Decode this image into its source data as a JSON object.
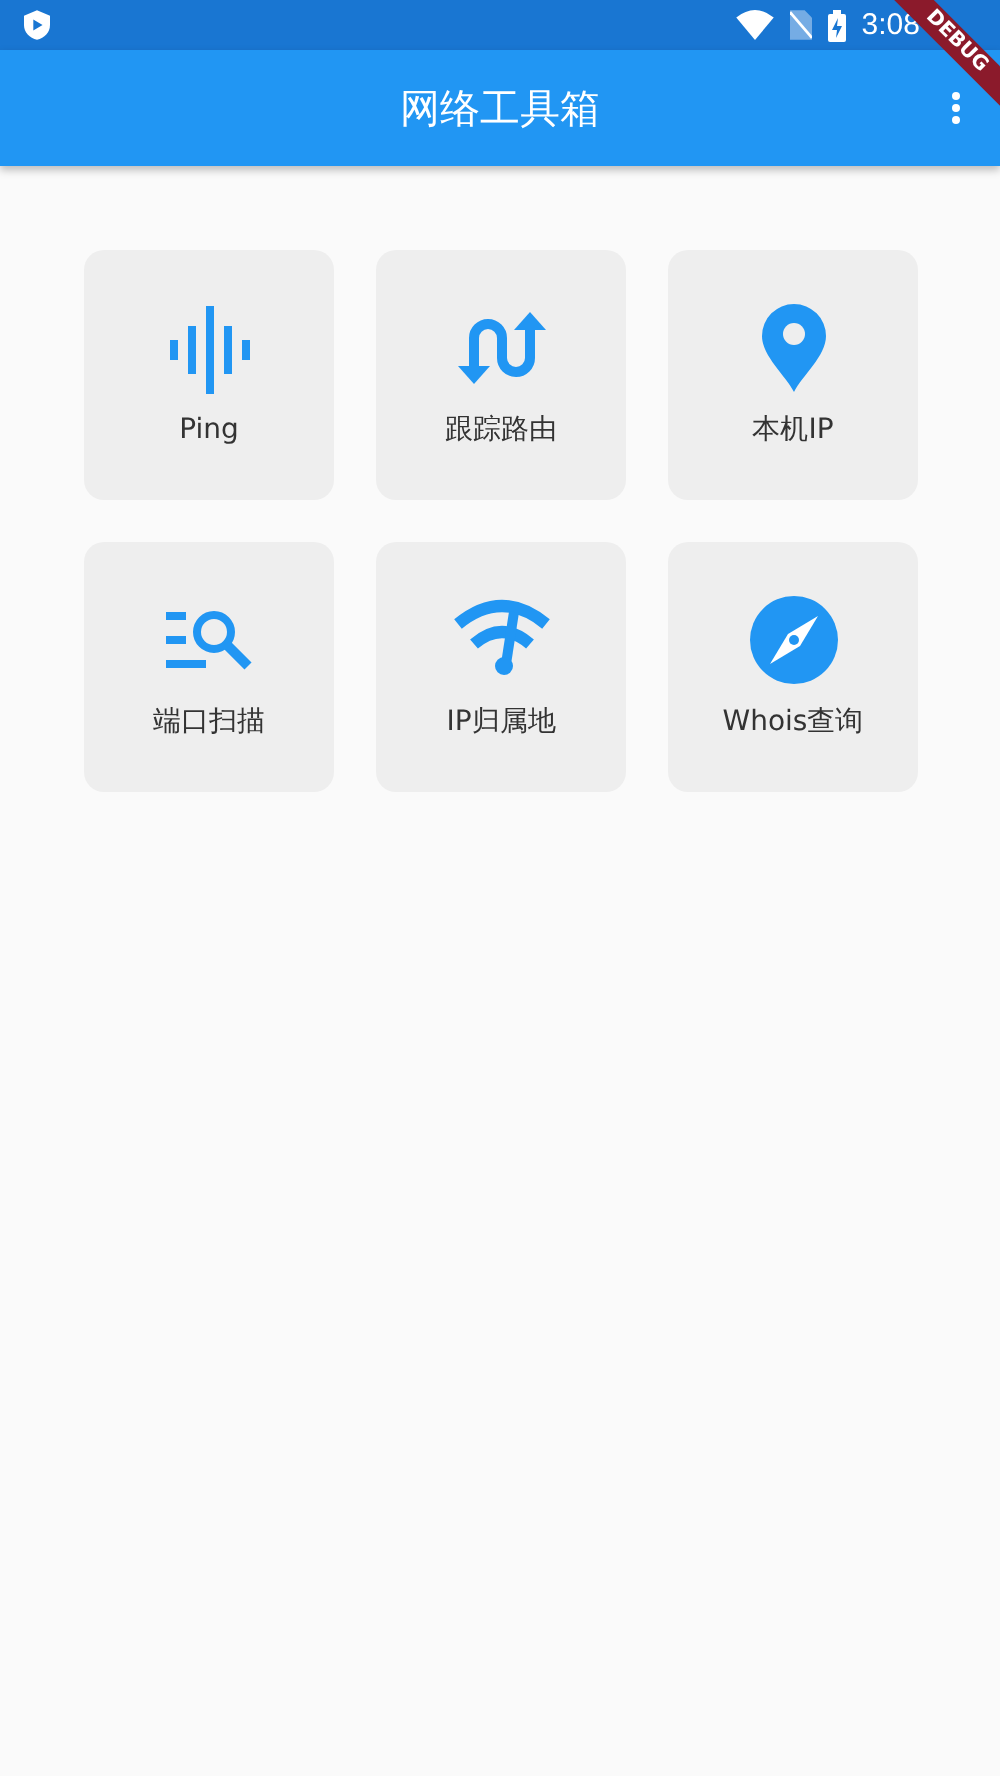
{
  "status_bar": {
    "time": "3:08"
  },
  "debug_banner": "DEBUG",
  "app_bar": {
    "title": "网络工具箱"
  },
  "tools": [
    {
      "kind": "ping",
      "label": "Ping"
    },
    {
      "kind": "route",
      "label": "跟踪路由"
    },
    {
      "kind": "location",
      "label": "本机IP"
    },
    {
      "kind": "scan",
      "label": "端口扫描"
    },
    {
      "kind": "wifi",
      "label": "IP归属地"
    },
    {
      "kind": "compass",
      "label": "Whois查询"
    }
  ]
}
